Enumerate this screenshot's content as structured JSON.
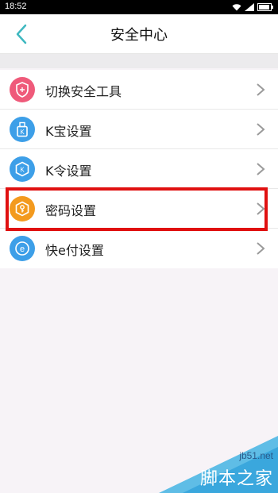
{
  "status_bar": {
    "time": "18:52"
  },
  "header": {
    "title": "安全中心"
  },
  "menu": {
    "items": [
      {
        "label": "切换安全工具",
        "icon": "shield-icon",
        "color": "#ef5a7a"
      },
      {
        "label": "K宝设置",
        "icon": "usb-key-icon",
        "color": "#3d9fe8"
      },
      {
        "label": "K令设置",
        "icon": "token-icon",
        "color": "#3d9fe8"
      },
      {
        "label": "密码设置",
        "icon": "key-icon",
        "color": "#f39a1e"
      },
      {
        "label": "快e付设置",
        "icon": "e-pay-icon",
        "color": "#3d9fe8"
      }
    ]
  },
  "watermark": {
    "url": "jb51.net",
    "site": "脚本之家"
  },
  "colors": {
    "accent": "#3fb8c0",
    "highlight": "#e01010"
  }
}
